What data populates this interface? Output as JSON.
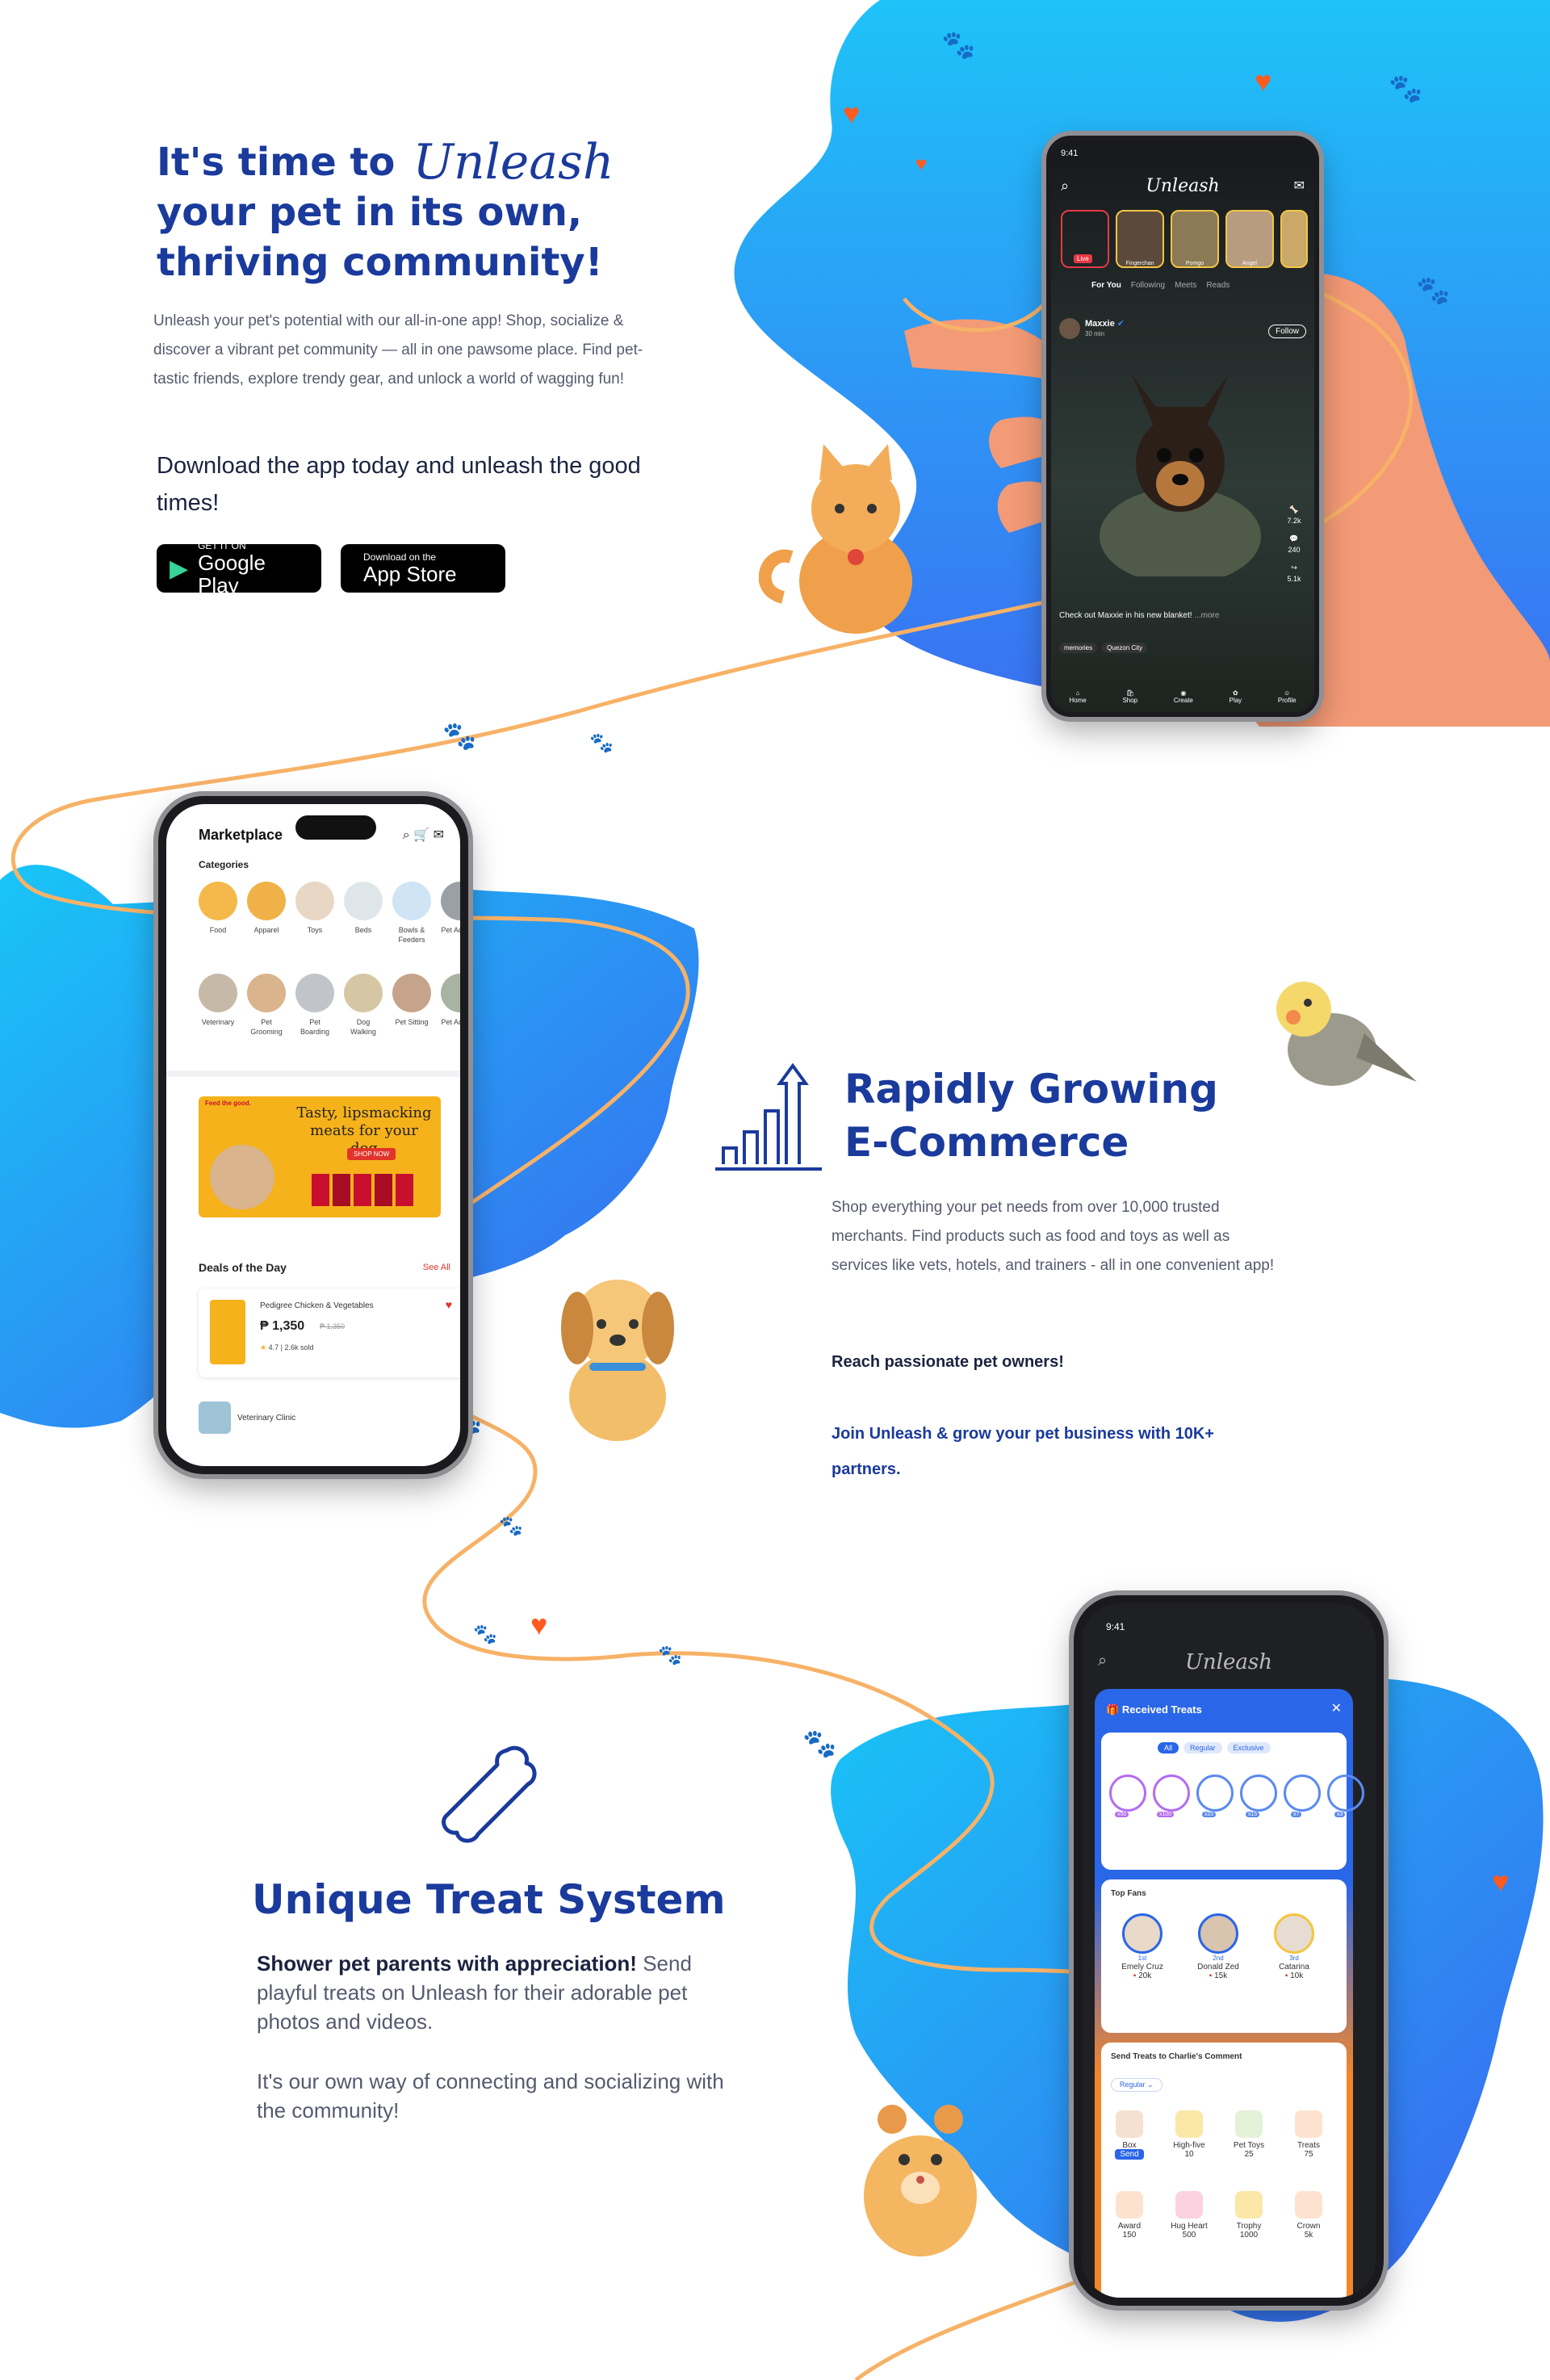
{
  "hero": {
    "title_line1": "It's time to",
    "brand": "Unleash",
    "title_line2": "your pet in its own,",
    "title_line3": "thriving community!",
    "description": "Unleash your pet's potential with our all-in-one app!  Shop, socialize & discover a vibrant pet community — all in one pawsome place.  Find pet-tastic friends, explore trendy gear, and unlock a world of wagging fun!",
    "cta": "Download the app today and unleash the good times!",
    "google_play": {
      "small": "GET IT ON",
      "big": "Google Play"
    },
    "app_store": {
      "small": "Download on the",
      "big": "App Store"
    }
  },
  "social_phone": {
    "time": "9:41",
    "brand": "Unleash",
    "live_label": "Live",
    "story_names": [
      "Fingerchan",
      "Pomgo",
      "Angel"
    ],
    "tabs": [
      "For You",
      "Following",
      "Meets",
      "Reads"
    ],
    "post_user": "Maxxie",
    "post_time": "30 min",
    "follow_label": "Follow",
    "likes": "7.2k",
    "comments": "240",
    "shares": "5.1k",
    "caption": "Check out Maxxie in his new blanket!",
    "more": "...more",
    "chip_album": "memories",
    "chip_location": "Quezon City",
    "nav": [
      "Home",
      "Shop",
      "Create",
      "Play",
      "Profile"
    ]
  },
  "market_phone": {
    "title": "Marketplace",
    "categories_label": "Categories",
    "categories_row1": [
      "Food",
      "Apparel",
      "Toys",
      "Beds",
      "Bowls & Feeders",
      "Pet Access."
    ],
    "categories_row2": [
      "Veterinary",
      "Pet Grooming",
      "Pet Boarding",
      "Dog Walking",
      "Pet Sitting",
      "Pet Access."
    ],
    "banner_headline": "Tasty, lipsmacking meats for your dog",
    "banner_button": "SHOP NOW",
    "banner_tag": "Feed the good.",
    "deals_label": "Deals of the Day",
    "see_all": "See All",
    "deal_name": "Pedigree Chicken & Vegetables",
    "deal_price": "₱ 1,350",
    "deal_old_price": "₱ 1,350",
    "deal_rating": "4.7",
    "deal_sold": "2.6k sold",
    "next_item": "Veterinary Clinic"
  },
  "ecommerce": {
    "title_line1": "Rapidly Growing",
    "title_line2": "E-Commerce",
    "description": "Shop everything your pet needs from over 10,000 trusted merchants. Find products such as food and toys as well as services like vets, hotels, and trainers - all in one convenient app!",
    "reach": "Reach passionate pet owners!",
    "join": "Join Unleash & grow your pet business with 10K+ partners."
  },
  "treat_section": {
    "title": "Unique Treat System",
    "lead": "Shower pet parents with appreciation!",
    "text1": " Send playful treats on Unleash for their adorable pet photos and videos.",
    "text2": "It's our own way of connecting and socializing with the community!"
  },
  "treat_phone": {
    "time": "9:41",
    "brand": "Unleash",
    "received_title": "Received Treats",
    "filter_all": "All",
    "filter_regular": "Regular",
    "filter_exclusive": "Exclusive",
    "received_counts": [
      "x50",
      "x100",
      "x20",
      "x15",
      "x7",
      "x3"
    ],
    "top_fans_label": "Top Fans",
    "fans": [
      {
        "rank": "1st",
        "name": "Emely Cruz",
        "score": "20k"
      },
      {
        "rank": "2nd",
        "name": "Donald Zed",
        "score": "15k"
      },
      {
        "rank": "3rd",
        "name": "Catarina",
        "score": "10k"
      }
    ],
    "send_title": "Send Treats to Charlie's Comment",
    "dropdown": "Regular",
    "treats_row1": [
      {
        "name": "Box",
        "cost": "Send"
      },
      {
        "name": "High-five",
        "cost": "10"
      },
      {
        "name": "Pet Toys",
        "cost": "25"
      },
      {
        "name": "Treats",
        "cost": "75"
      }
    ],
    "treats_row2": [
      {
        "name": "Award",
        "cost": "150"
      },
      {
        "name": "Hug Heart",
        "cost": "500"
      },
      {
        "name": "Trophy",
        "cost": "1000"
      },
      {
        "name": "Crown",
        "cost": "5k"
      }
    ]
  },
  "colors": {
    "brand_blue": "#1a3a9c",
    "blob_light": "#29b5f6",
    "blob_dark": "#3d6cf0",
    "ribbon": "#f7b267",
    "accent_orange": "#ff7a1f",
    "hand_skin": "#f39a76"
  }
}
